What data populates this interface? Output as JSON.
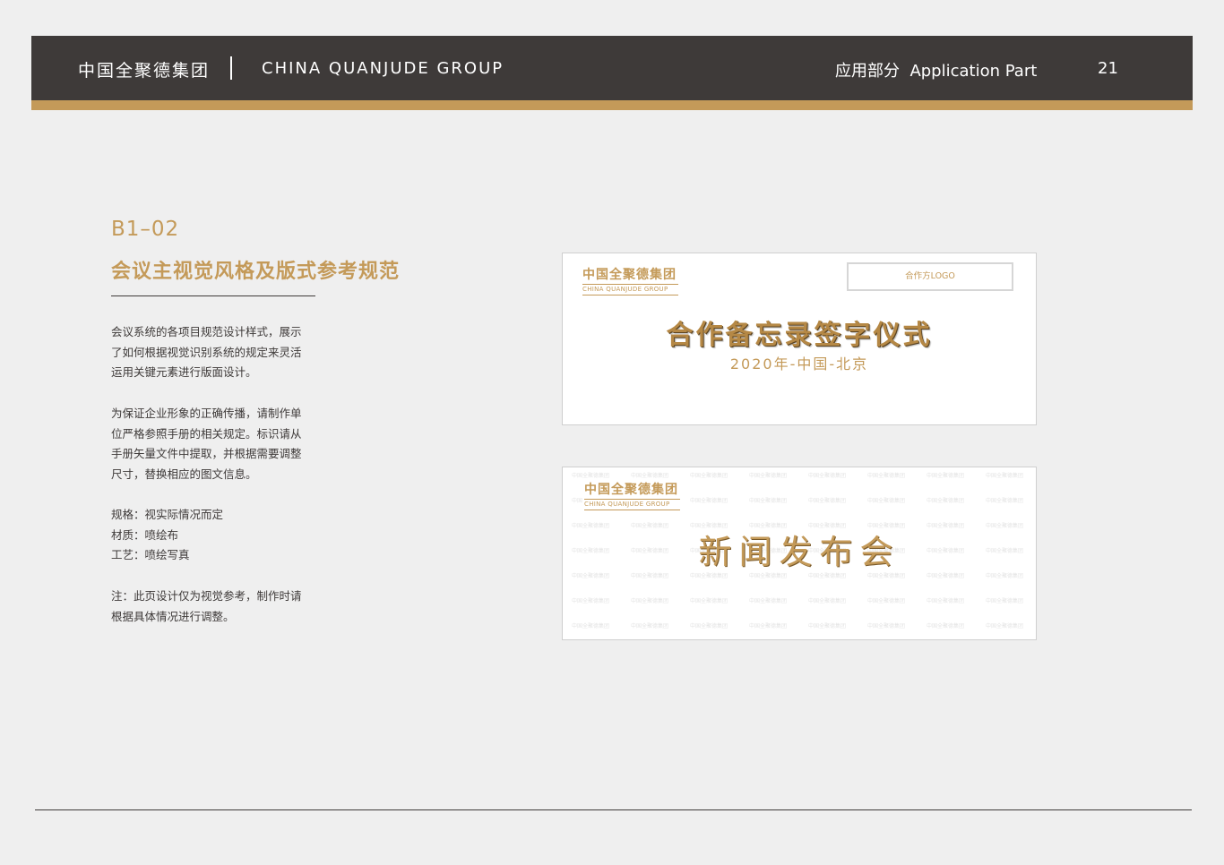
{
  "header": {
    "brand_cn": "中国全聚德集团",
    "brand_en": "CHINA QUANJUDE GROUP",
    "section": "应用部分  Application Part",
    "page_number": "21"
  },
  "content": {
    "code": "B1–02",
    "title": "会议主视觉风格及版式参考规范",
    "p1": [
      "会议系统的各项目规范设计样式，展示",
      "了如何根据视觉识别系统的规定来灵活",
      "运用关键元素进行版面设计。"
    ],
    "p2": [
      "为保证企业形象的正确传播，请制作单",
      "位严格参照手册的相关规定。标识请从",
      "手册矢量文件中提取，并根据需要调整",
      "尺寸，替换相应的图文信息。"
    ],
    "p3": [
      "规格：视实际情况而定",
      "材质：喷绘布",
      "工艺：喷绘写真"
    ],
    "p4": [
      "注：此页设计仅为视觉参考，制作时请",
      "根据具体情况进行调整。"
    ]
  },
  "board1": {
    "logo_cn": "中国全聚德集团",
    "logo_en": "CHINA QUANJUDE GROUP",
    "partner": "合作方LOGO",
    "title": "合作备忘录签字仪式",
    "subtitle": "2020年-中国-北京"
  },
  "board2": {
    "logo_cn": "中国全聚德集团",
    "logo_en": "CHINA QUANJUDE GROUP",
    "title": "新闻发布会",
    "pattern_text": "中国全聚德集团"
  },
  "colors": {
    "header_bg": "#3e3a39",
    "accent_gold": "#c49a59",
    "page_bg": "#efefef"
  }
}
